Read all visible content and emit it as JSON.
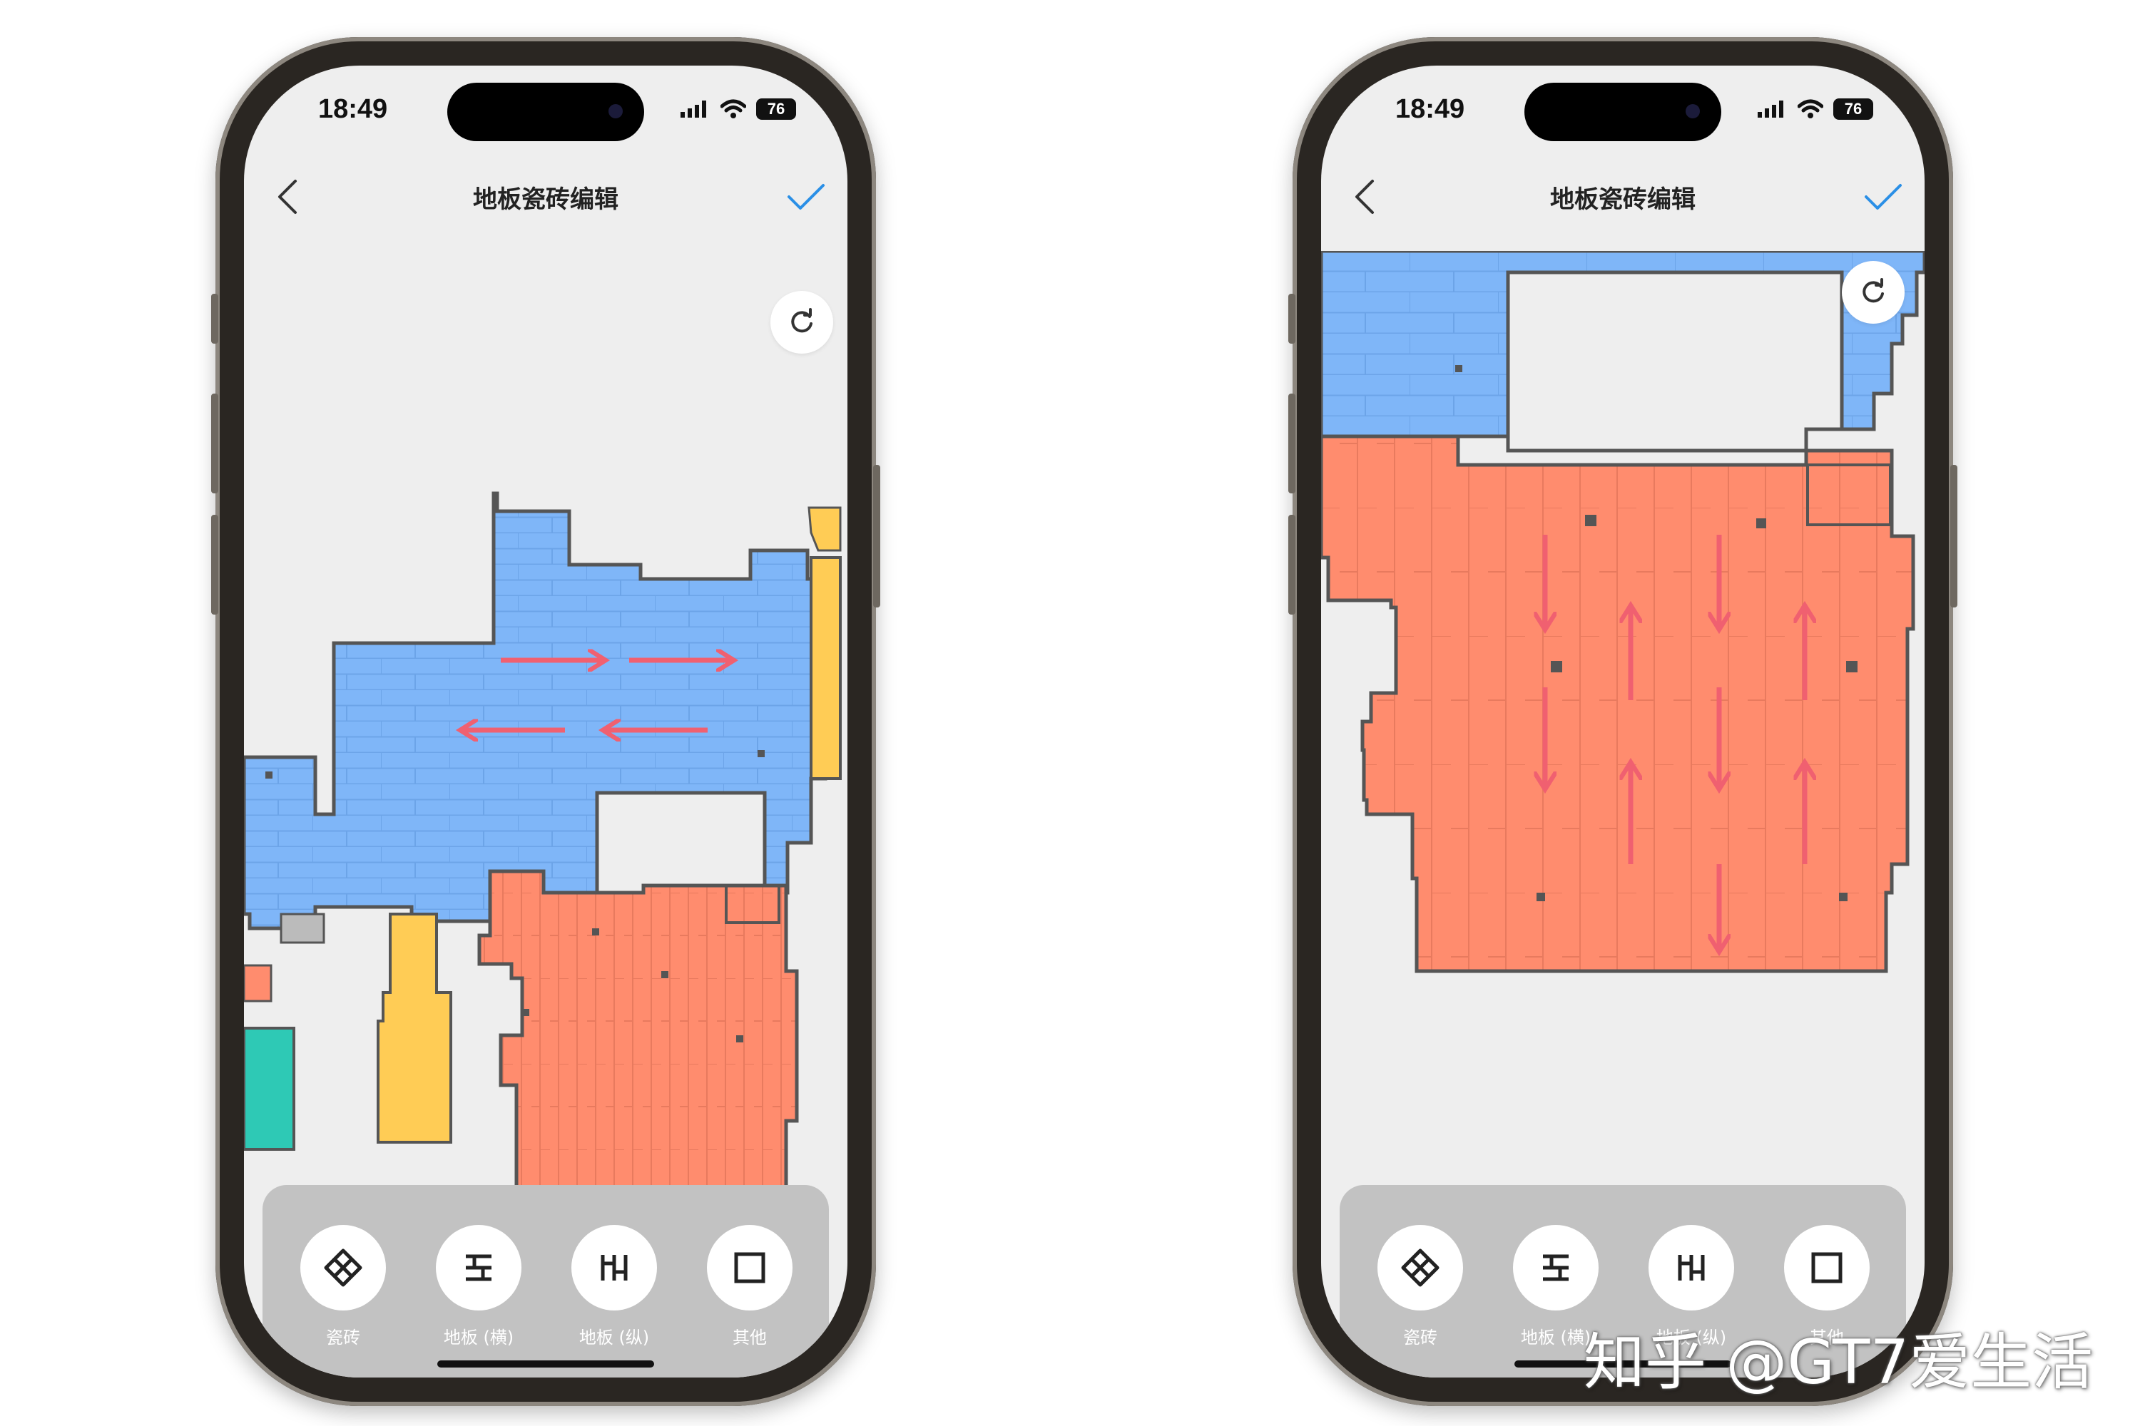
{
  "status_bar": {
    "time": "18:49",
    "battery": "76"
  },
  "screen": {
    "title": "地板瓷砖编辑"
  },
  "toolbar": {
    "items": [
      {
        "label": "瓷砖",
        "icon": "tile-diamond-icon"
      },
      {
        "label": "地板 (横)",
        "icon": "floor-horizontal-icon"
      },
      {
        "label": "地板 (纵)",
        "icon": "floor-vertical-icon"
      },
      {
        "label": "其他",
        "icon": "square-outline-icon"
      }
    ]
  },
  "watermark": "知乎 @GT7爱生活",
  "colors": {
    "tile_room": "#7fb6f8",
    "floor_horizontal_room": "#ff8c6e",
    "yellow_room": "#ffcc55",
    "teal_room": "#2ec9b5",
    "wall": "#555555",
    "accent": "#2a8fe6",
    "arrow": "#f06070"
  }
}
